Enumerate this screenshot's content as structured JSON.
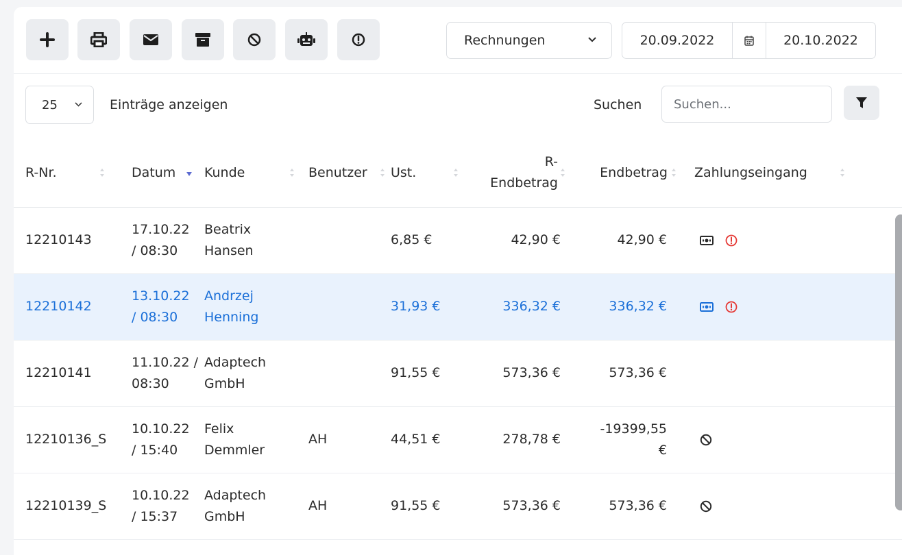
{
  "toolbar": {
    "buttons": [
      "plus-icon",
      "print-icon",
      "envelope-icon",
      "archive-icon",
      "ban-icon",
      "robot-icon",
      "exclamation-circle-icon"
    ]
  },
  "doc_type": {
    "selected": "Rechnungen"
  },
  "date_range": {
    "from": "20.09.2022",
    "to": "20.10.2022"
  },
  "entries": {
    "selected": "25",
    "label": "Einträge anzeigen"
  },
  "search": {
    "label": "Suchen",
    "placeholder": "Suchen..."
  },
  "table": {
    "headers": {
      "rnr": "R-Nr.",
      "datum": "Datum",
      "kunde": "Kunde",
      "benutzer": "Benutzer",
      "ust": "Ust.",
      "r_endbetrag_1": "R-",
      "r_endbetrag_2": "Endbetrag",
      "endbetrag": "Endbetrag",
      "zahlung": "Zahlungseingang"
    },
    "rows": [
      {
        "rnr": "12210143",
        "datum_1": "17.10.22",
        "datum_2": "/ 08:30",
        "kunde_1": "Beatrix",
        "kunde_2": "Hansen",
        "benutzer": "",
        "ust": "6,85 €",
        "r_endbetrag": "42,90 €",
        "endbetrag_1": "42,90 €",
        "endbetrag_2": ""
      },
      {
        "rnr": "12210142",
        "datum_1": "13.10.22",
        "datum_2": "/ 08:30",
        "kunde_1": "Andrzej",
        "kunde_2": "Henning",
        "benutzer": "",
        "ust": "31,93 €",
        "r_endbetrag": "336,32 €",
        "endbetrag_1": "336,32 €",
        "endbetrag_2": ""
      },
      {
        "rnr": "12210141",
        "datum_1": "11.10.22 /",
        "datum_2": "08:30",
        "kunde_1": "Adaptech",
        "kunde_2": "GmbH",
        "benutzer": "",
        "ust": "91,55 €",
        "r_endbetrag": "573,36 €",
        "endbetrag_1": "573,36 €",
        "endbetrag_2": ""
      },
      {
        "rnr": "12210136_S",
        "datum_1": "10.10.22",
        "datum_2": "/ 15:40",
        "kunde_1": "Felix",
        "kunde_2": "Demmler",
        "benutzer": "AH",
        "ust": "44,51 €",
        "r_endbetrag": "278,78 €",
        "endbetrag_1": "-19399,55",
        "endbetrag_2": "€"
      },
      {
        "rnr": "12210139_S",
        "datum_1": "10.10.22",
        "datum_2": "/ 15:37",
        "kunde_1": "Adaptech",
        "kunde_2": "GmbH",
        "benutzer": "AH",
        "ust": "91,55 €",
        "r_endbetrag": "573,36 €",
        "endbetrag_1": "573,36 €",
        "endbetrag_2": ""
      }
    ]
  },
  "colors": {
    "accent": "#1a6fd8",
    "selected_row": "#e9f2fd",
    "warning": "#e53935",
    "sort_active": "#5b6ad0"
  }
}
